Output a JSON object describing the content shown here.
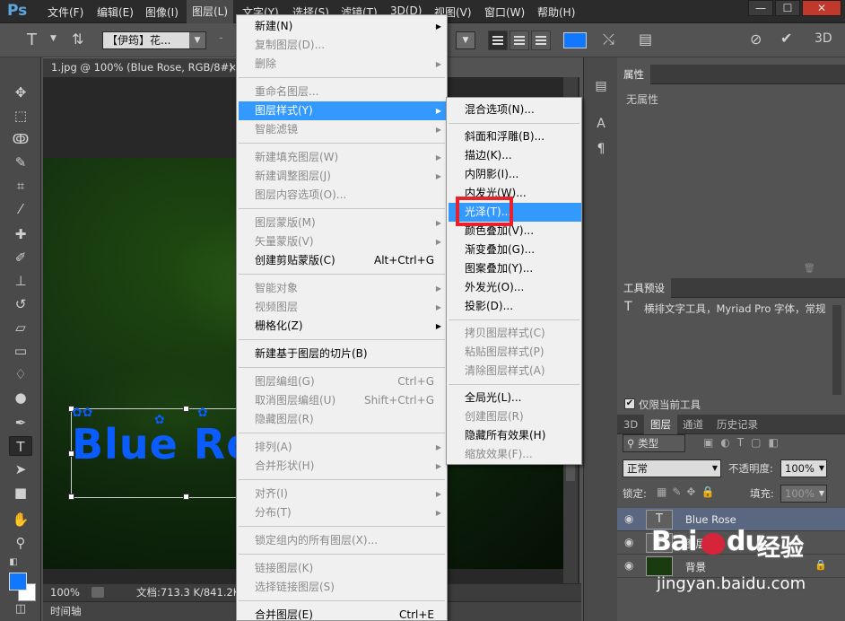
{
  "app_logo": "Ps",
  "menubar": {
    "items": [
      "文件(F)",
      "编辑(E)",
      "图像(I)",
      "图层(L)",
      "文字(Y)",
      "选择(S)",
      "滤镜(T)",
      "3D(D)",
      "视图(V)",
      "窗口(W)",
      "帮助(H)"
    ],
    "window_buttons": [
      "—",
      "☐",
      "✕"
    ]
  },
  "options_bar": {
    "font_family": "【伊筠】花...",
    "size_text": "-",
    "color": "#1177ff"
  },
  "document": {
    "tab_title": "1.jpg @ 100% (Blue Rose, RGB/8#) *",
    "tab_close": "×",
    "text_content": "Blue Ro",
    "zoom": "100%",
    "doc_info": "文档:713.3 K/841.2K",
    "timeline_label": "时间轴"
  },
  "layer_menu": {
    "items": [
      {
        "label": "新建(N)",
        "disabled": false,
        "submenu": true
      },
      {
        "label": "复制图层(D)...",
        "disabled": true
      },
      {
        "label": "删除",
        "disabled": true,
        "submenu": true
      },
      {
        "label": "重命名图层...",
        "disabled": true
      },
      {
        "label": "图层样式(Y)",
        "disabled": false,
        "submenu": true,
        "highlighted": true
      },
      {
        "label": "智能滤镜",
        "disabled": true,
        "submenu": true
      },
      {
        "label": "新建填充图层(W)",
        "disabled": true,
        "submenu": true
      },
      {
        "label": "新建调整图层(J)",
        "disabled": true,
        "submenu": true
      },
      {
        "label": "图层内容选项(O)...",
        "disabled": true
      },
      {
        "label": "图层蒙版(M)",
        "disabled": true,
        "submenu": true
      },
      {
        "label": "矢量蒙版(V)",
        "disabled": true,
        "submenu": true
      },
      {
        "label": "创建剪贴蒙版(C)",
        "disabled": false,
        "shortcut": "Alt+Ctrl+G"
      },
      {
        "label": "智能对象",
        "disabled": true,
        "submenu": true
      },
      {
        "label": "视频图层",
        "disabled": true,
        "submenu": true
      },
      {
        "label": "栅格化(Z)",
        "disabled": false,
        "submenu": true
      },
      {
        "label": "新建基于图层的切片(B)",
        "disabled": false
      },
      {
        "label": "图层编组(G)",
        "disabled": true,
        "shortcut": "Ctrl+G"
      },
      {
        "label": "取消图层编组(U)",
        "disabled": true,
        "shortcut": "Shift+Ctrl+G"
      },
      {
        "label": "隐藏图层(R)",
        "disabled": true
      },
      {
        "label": "排列(A)",
        "disabled": true,
        "submenu": true
      },
      {
        "label": "合并形状(H)",
        "disabled": true,
        "submenu": true
      },
      {
        "label": "对齐(I)",
        "disabled": true,
        "submenu": true
      },
      {
        "label": "分布(T)",
        "disabled": true,
        "submenu": true
      },
      {
        "label": "锁定组内的所有图层(X)...",
        "disabled": true
      },
      {
        "label": "链接图层(K)",
        "disabled": true
      },
      {
        "label": "选择链接图层(S)",
        "disabled": true
      },
      {
        "label": "合并图层(E)",
        "disabled": false,
        "shortcut": "Ctrl+E"
      }
    ]
  },
  "style_submenu": {
    "items": [
      {
        "label": "混合选项(N)...",
        "disabled": false
      },
      {
        "label": "斜面和浮雕(B)...",
        "disabled": false
      },
      {
        "label": "描边(K)...",
        "disabled": false
      },
      {
        "label": "内阴影(I)...",
        "disabled": false
      },
      {
        "label": "内发光(W)...",
        "disabled": false
      },
      {
        "label": "光泽(T)...",
        "disabled": false,
        "highlighted": true
      },
      {
        "label": "颜色叠加(V)...",
        "disabled": false
      },
      {
        "label": "渐变叠加(G)...",
        "disabled": false
      },
      {
        "label": "图案叠加(Y)...",
        "disabled": false
      },
      {
        "label": "外发光(O)...",
        "disabled": false
      },
      {
        "label": "投影(D)...",
        "disabled": false
      },
      {
        "label": "拷贝图层样式(C)",
        "disabled": true
      },
      {
        "label": "粘贴图层样式(P)",
        "disabled": true
      },
      {
        "label": "清除图层样式(A)",
        "disabled": true
      },
      {
        "label": "全局光(L)...",
        "disabled": false
      },
      {
        "label": "创建图层(R)",
        "disabled": true
      },
      {
        "label": "隐藏所有效果(H)",
        "disabled": false
      },
      {
        "label": "缩放效果(F)...",
        "disabled": true
      }
    ]
  },
  "properties_panel": {
    "tab": "属性",
    "content": "无属性"
  },
  "tool_presets_panel": {
    "tab": "工具预设",
    "item": "横排文字工具，Myriad Pro 字体，常规",
    "checkbox_label": "仅限当前工具",
    "checkbox_mark": "✔"
  },
  "layers_panel": {
    "tabs": [
      "3D",
      "图层",
      "通道",
      "历史记录"
    ],
    "filter_label": "类型",
    "blend_mode": "正常",
    "opacity_label": "不透明度:",
    "opacity_value": "100%",
    "lock_label": "锁定:",
    "fill_label": "填充:",
    "fill_value": "100%",
    "layers": [
      {
        "name": "Blue Rose",
        "type": "T",
        "selected": true
      },
      {
        "name": "图层",
        "type": "T",
        "selected": false
      },
      {
        "name": "背景",
        "type": "img",
        "selected": false
      }
    ]
  },
  "watermark": {
    "brand": "Bai",
    "brand2": "du",
    "cn": "经验",
    "url": "jingyan.baidu.com"
  }
}
